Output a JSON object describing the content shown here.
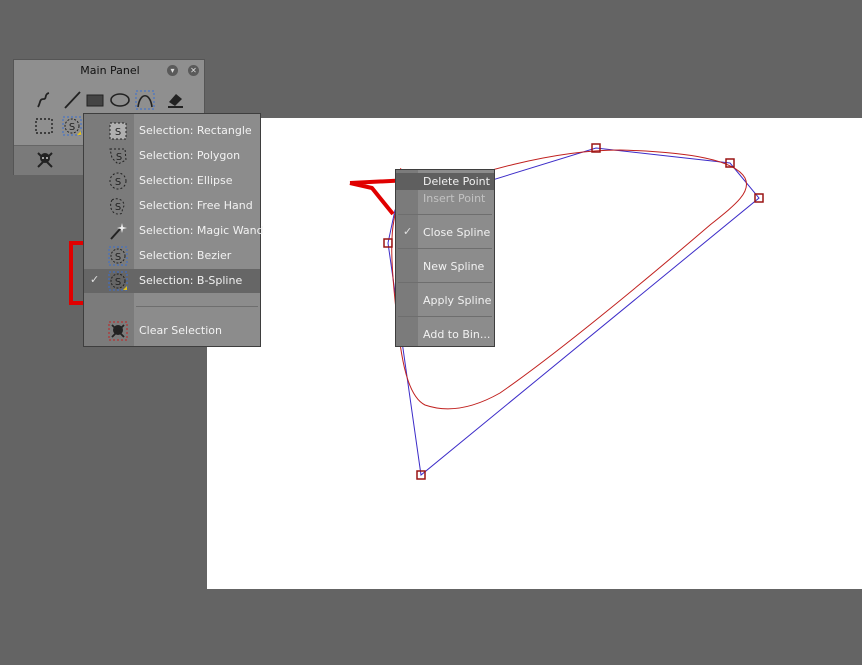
{
  "main_panel": {
    "title": "Main Panel",
    "tools_row1": [
      "freehand-curve-icon",
      "line-icon",
      "rectangle-icon",
      "ellipse-icon",
      "spline-curve-icon",
      "eraser-icon"
    ],
    "tools_row2": [
      "rectangle-selection-icon",
      "bspline-selection-icon"
    ],
    "bottom_tools": [
      "clear-selection-icon"
    ]
  },
  "selection_menu": {
    "items": [
      {
        "label": "Selection: Rectangle",
        "icon": "selection-rectangle-icon",
        "checked": false
      },
      {
        "label": "Selection: Polygon",
        "icon": "selection-polygon-icon",
        "checked": false
      },
      {
        "label": "Selection: Ellipse",
        "icon": "selection-ellipse-icon",
        "checked": false
      },
      {
        "label": "Selection: Free Hand",
        "icon": "selection-freehand-icon",
        "checked": false
      },
      {
        "label": "Selection: Magic Wand",
        "icon": "selection-magic-wand-icon",
        "checked": false
      },
      {
        "label": "Selection: Bezier",
        "icon": "selection-bezier-icon",
        "checked": false
      },
      {
        "label": "Selection: B-Spline",
        "icon": "selection-bspline-icon",
        "checked": true
      },
      {
        "label": "Clear Selection",
        "icon": "clear-selection-icon",
        "checked": false
      }
    ],
    "check_mark": "✓"
  },
  "context_menu": {
    "items": [
      {
        "label": "Delete Point",
        "state": "highlighted"
      },
      {
        "label": "Insert Point",
        "state": "disabled"
      },
      {
        "label": "Close Spline",
        "state": "checked"
      },
      {
        "label": "New Spline",
        "state": "normal"
      },
      {
        "label": "Apply Spline",
        "state": "normal"
      },
      {
        "label": "Add to Bin...",
        "state": "normal"
      }
    ],
    "check_mark": "✓"
  },
  "colors": {
    "workspace_bg": "#646464",
    "canvas_bg": "#ffffff",
    "control_polygon": "#3c2cc8",
    "spline_curve": "#c0201e",
    "control_point": "#9a1414",
    "annotation": "#e00000"
  }
}
